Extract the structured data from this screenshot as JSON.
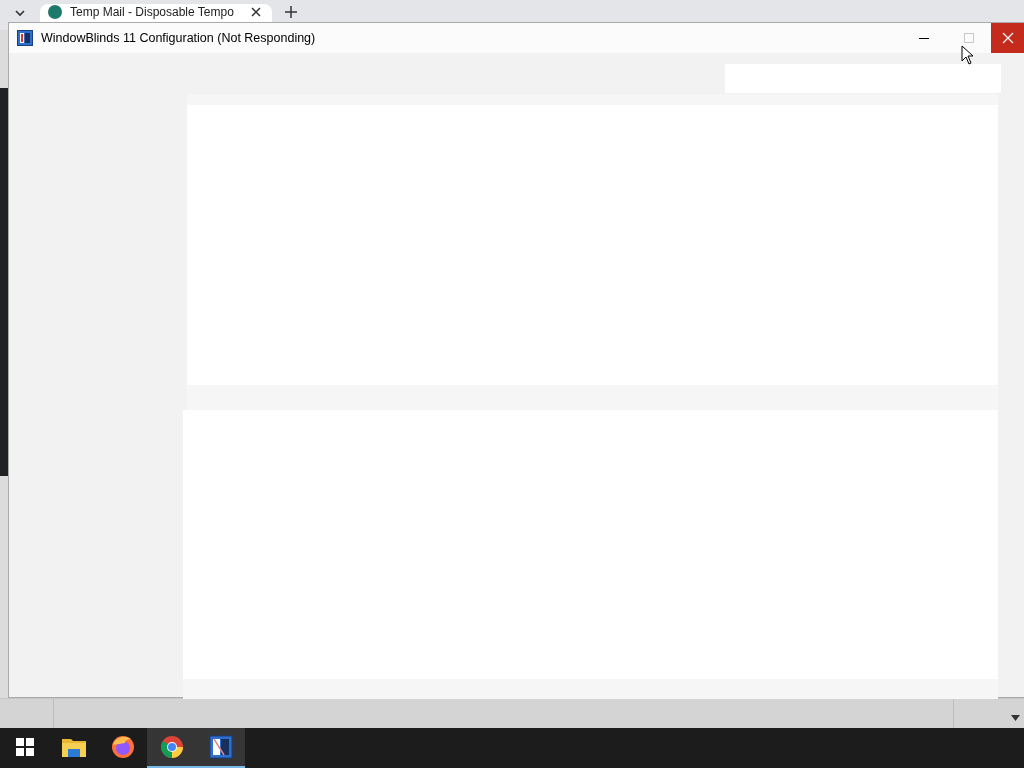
{
  "browser": {
    "tab_title": "Temp Mail - Disposable Tempo"
  },
  "window": {
    "title": "WindowBlinds 11 Configuration (Not Responding)",
    "maximize_disabled": true
  },
  "taskbar": {
    "items": [
      {
        "kind": "start",
        "open": false
      },
      {
        "kind": "folder",
        "open": false
      },
      {
        "kind": "firefox",
        "open": false
      },
      {
        "kind": "chrome",
        "open": true
      },
      {
        "kind": "app",
        "open": true
      }
    ]
  }
}
